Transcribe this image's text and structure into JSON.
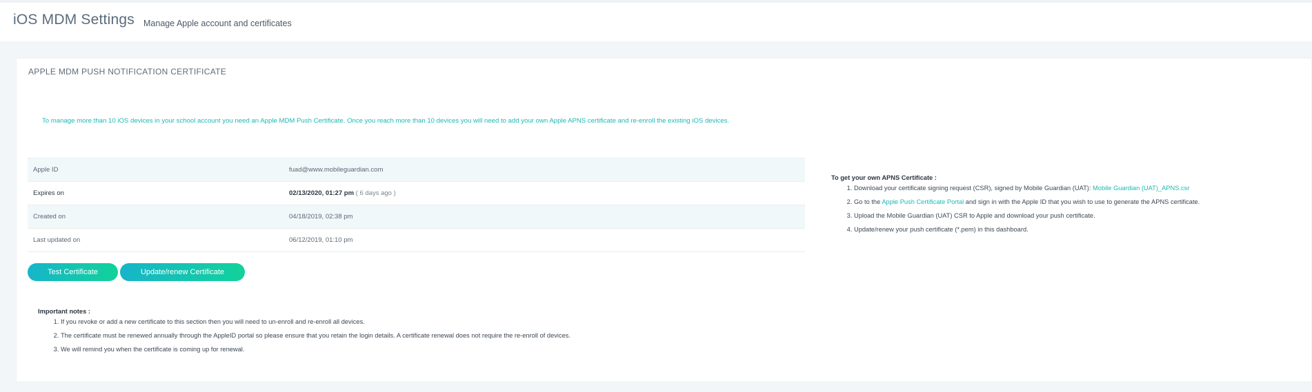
{
  "header": {
    "title": "iOS MDM Settings",
    "subtitle": "Manage Apple account and certificates"
  },
  "card": {
    "title": "APPLE MDM PUSH NOTIFICATION CERTIFICATE",
    "info": "To manage more than 10 iOS devices in your school account you need an Apple MDM Push Certificate. Once you reach more than 10 devices you will need to add your own Apple APNS certificate and re-enroll the existing iOS devices.",
    "details": {
      "apple_id_label": "Apple ID",
      "apple_id_value": "fuad@www.mobileguardian.com",
      "expires_label": "Expires on",
      "expires_value": "02/13/2020, 01:27 pm",
      "expires_relative": "( 6 days ago )",
      "created_label": "Created on",
      "created_value": "04/18/2019, 02:38 pm",
      "updated_label": "Last updated on",
      "updated_value": "06/12/2019, 01:10 pm"
    },
    "buttons": {
      "test": "Test Certificate",
      "update": "Update/renew Certificate"
    },
    "notes": {
      "heading": "Important notes :",
      "items": [
        "If you revoke or add a new certificate to this section then you will need to un-enroll and re-enroll all devices.",
        "The certificate must be renewed annually through the AppleID portal so please ensure that you retain the login details. A certificate renewal does not require the re-enroll of devices.",
        "We will remind you when the certificate is coming up for renewal."
      ]
    },
    "apns": {
      "heading": "To get your own APNS Certificate :",
      "step1_text": "Download your certificate signing request (CSR), signed by Mobile Guardian (UAT): ",
      "step1_link": "Mobile Guardian (UAT)_APNS.csr",
      "step2_pre": "Go to the ",
      "step2_link": "Apple Push Certificate Portal",
      "step2_post": " and sign in with the Apple ID that you wish to use to generate the APNS certificate.",
      "step3": "Upload the Mobile Guardian (UAT) CSR to Apple and download your push certificate.",
      "step4": "Update/renew your push certificate (*.pem) in this dashboard."
    }
  }
}
